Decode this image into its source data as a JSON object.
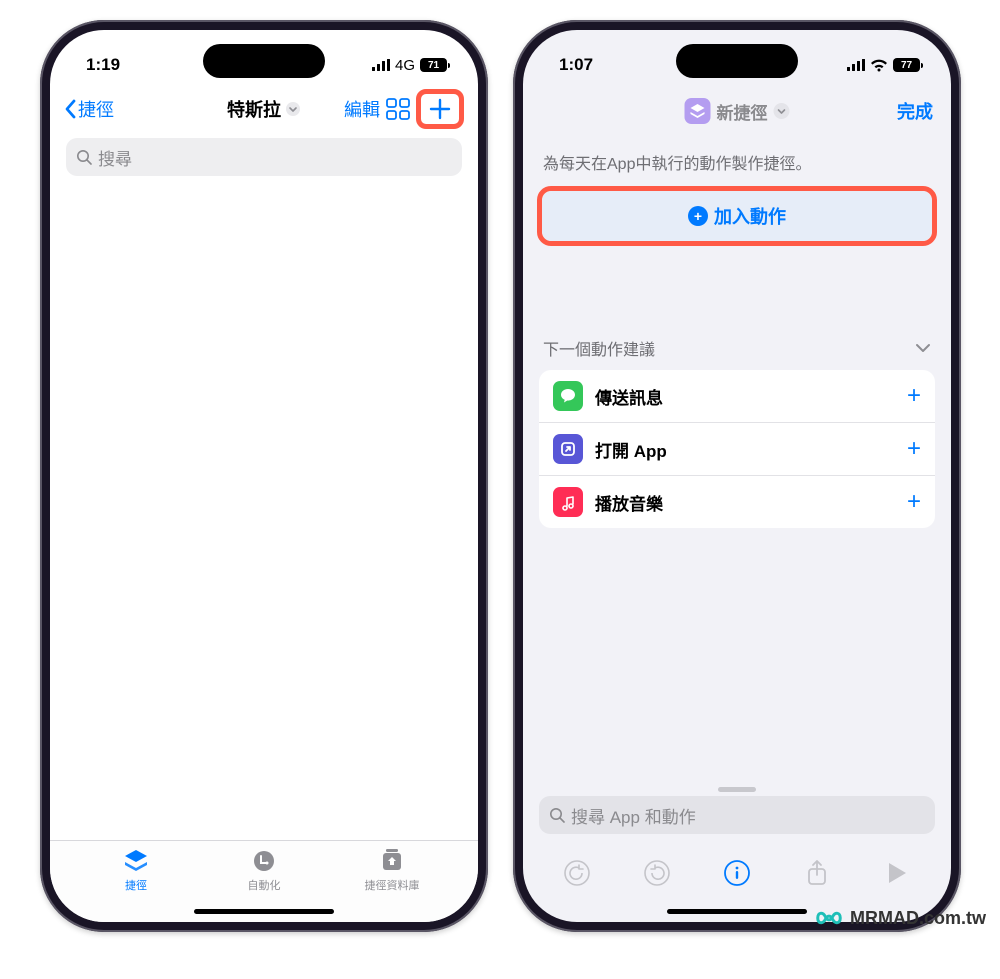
{
  "left": {
    "status": {
      "time": "1:19",
      "network": "4G",
      "battery": "71"
    },
    "nav": {
      "back": "捷徑",
      "title": "特斯拉",
      "edit": "編輯"
    },
    "search": {
      "placeholder": "搜尋"
    },
    "tabs": {
      "shortcuts": "捷徑",
      "automation": "自動化",
      "gallery": "捷徑資料庫"
    }
  },
  "right": {
    "status": {
      "time": "1:07",
      "battery": "77"
    },
    "nav": {
      "title": "新捷徑",
      "done": "完成"
    },
    "hint": "為每天在App中執行的動作製作捷徑。",
    "add_action": "加入動作",
    "suggest_header": "下一個動作建議",
    "suggestions": [
      {
        "label": "傳送訊息",
        "color": "#34c759",
        "icon": "message"
      },
      {
        "label": "打開 App",
        "color": "#5856d6",
        "icon": "open-app"
      },
      {
        "label": "播放音樂",
        "color": "#ff2d55",
        "icon": "music"
      }
    ],
    "search": {
      "placeholder": "搜尋 App 和動作"
    }
  },
  "watermark": "MRMAD.com.tw"
}
